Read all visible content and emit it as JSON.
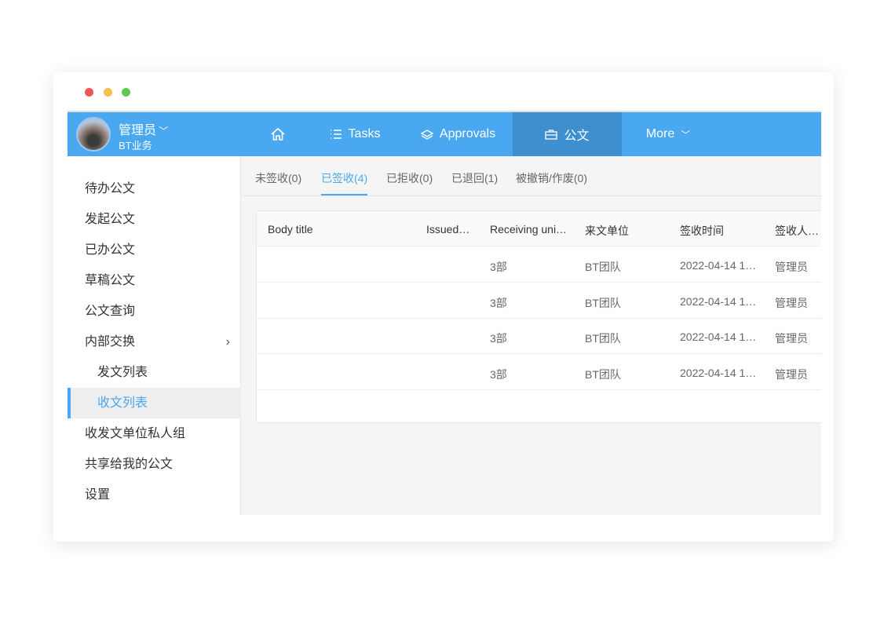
{
  "window": {
    "dots": [
      "#f0555a",
      "#f5bf4f",
      "#62c655"
    ]
  },
  "header": {
    "user_name": "管理员",
    "org": "BT业务",
    "nav": [
      {
        "label": "",
        "icon": "home-icon"
      },
      {
        "label": "Tasks",
        "icon": "list-icon"
      },
      {
        "label": "Approvals",
        "icon": "layers-icon"
      },
      {
        "label": "公文",
        "icon": "briefcase-icon",
        "active": true
      },
      {
        "label": "More",
        "icon": "chevron-down-icon"
      }
    ]
  },
  "sidebar": {
    "items": [
      {
        "label": "待办公文"
      },
      {
        "label": "发起公文"
      },
      {
        "label": "已办公文"
      },
      {
        "label": "草稿公文"
      },
      {
        "label": "公文查询"
      },
      {
        "label": "内部交换"
      },
      {
        "label": "发文列表"
      },
      {
        "label": "收文列表",
        "selected": true
      },
      {
        "label": "收发文单位私人组"
      },
      {
        "label": "共享给我的公文"
      },
      {
        "label": "设置"
      }
    ]
  },
  "tabs": [
    {
      "label": "未签收(0)"
    },
    {
      "label": "已签收(4)",
      "active": true
    },
    {
      "label": "已拒收(0)"
    },
    {
      "label": "已退回(1)"
    },
    {
      "label": "被撤销/作废(0)"
    }
  ],
  "table": {
    "columns": [
      "Body title",
      "Issued…",
      "Receiving uni…",
      "来文单位",
      "签收时间",
      "签收人…"
    ],
    "rows": [
      [
        "",
        "",
        "3部",
        "BT团队",
        "2022-04-14 1…",
        "管理员"
      ],
      [
        "",
        "",
        "3部",
        "BT团队",
        "2022-04-14 1…",
        "管理员"
      ],
      [
        "",
        "",
        "3部",
        "BT团队",
        "2022-04-14 1…",
        "管理员"
      ],
      [
        "",
        "",
        "3部",
        "BT团队",
        "2022-04-14 1…",
        "管理员"
      ]
    ]
  },
  "colors": {
    "accent": "#4aa8f0",
    "nav_active": "#3d8fcf"
  }
}
